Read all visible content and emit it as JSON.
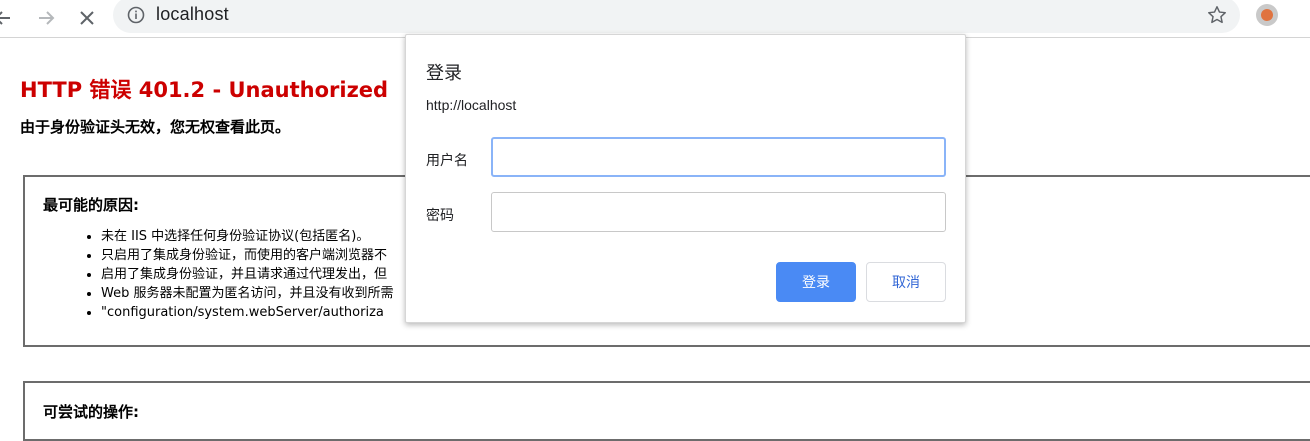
{
  "browser": {
    "url": "localhost",
    "icons": {
      "back": "arrow-left-icon",
      "forward": "arrow-right-icon",
      "stop": "close-icon",
      "site_info": "info-icon",
      "bookmark": "star-icon",
      "extension": "extension-icon"
    }
  },
  "error_page": {
    "title": "HTTP 错误 401.2 - Unauthorized",
    "subtitle": "由于身份验证头无效，您无权查看此页。",
    "causes": {
      "heading": "最可能的原因:",
      "items": [
        "未在 IIS 中选择任何身份验证协议(包括匿名)。",
        "只启用了集成身份验证，而使用的客户端浏览器不",
        "启用了集成身份验证，并且请求通过代理发出，但",
        "Web 服务器未配置为匿名访问，并且没有收到所需",
        "\"configuration/system.webServer/authoriza"
      ]
    },
    "actions": {
      "heading": "可尝试的操作:"
    },
    "colors": {
      "title": "#cc0000"
    }
  },
  "dialog": {
    "title": "登录",
    "origin": "http://localhost",
    "username_label": "用户名",
    "username_value": "",
    "password_label": "密码",
    "password_value": "",
    "login_label": "登录",
    "cancel_label": "取消",
    "colors": {
      "primary": "#4a8af4",
      "focus_ring": "#8ab4f8"
    }
  }
}
